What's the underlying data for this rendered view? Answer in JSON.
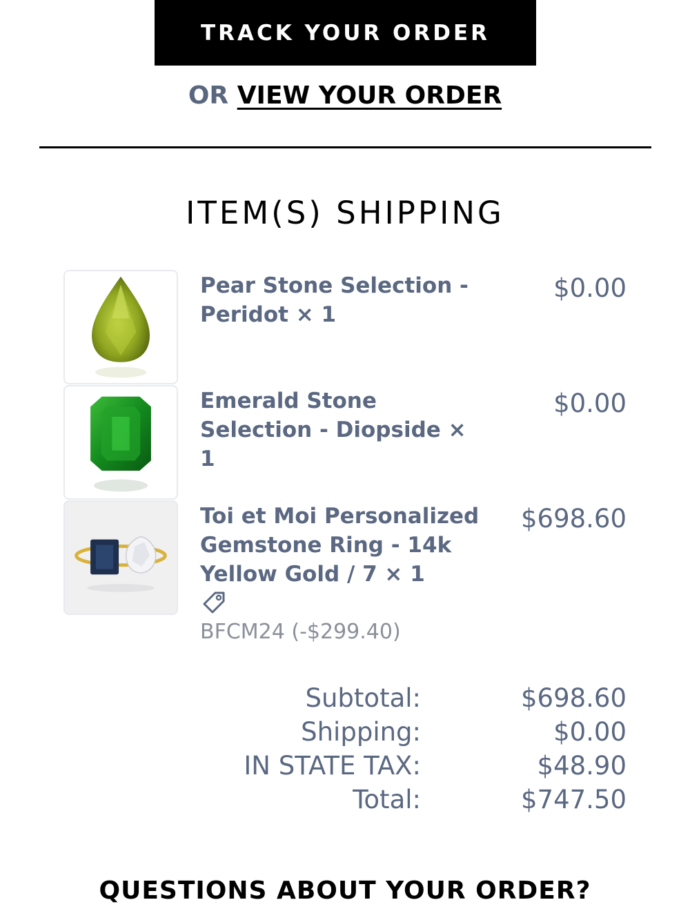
{
  "header": {
    "track_label": "TRACK YOUR ORDER",
    "or_text": "OR",
    "view_label": "VIEW YOUR ORDER"
  },
  "section_title": "ITEM(S) SHIPPING",
  "items": [
    {
      "name_lines": [
        "Pear Stone Selection -",
        "Peridot × 1"
      ],
      "price": "$0.00",
      "image_icon": "peridot-pear-gem-icon"
    },
    {
      "name_lines": [
        "Emerald Stone",
        "Selection - Diopside ×",
        "1"
      ],
      "price": "$0.00",
      "image_icon": "diopside-emerald-gem-icon"
    },
    {
      "name_lines": [
        "Toi et Moi Personalized",
        "Gemstone Ring - 14k",
        "Yellow Gold / 7 × 1"
      ],
      "price": "$698.60",
      "image_icon": "toi-et-moi-ring-icon",
      "discount": "BFCM24 (-$299.40)",
      "discount_icon": "tag-icon"
    }
  ],
  "summary": [
    {
      "label": "Subtotal:",
      "value": "$698.60"
    },
    {
      "label": "Shipping:",
      "value": "$0.00"
    },
    {
      "label": "IN STATE TAX:",
      "value": "$48.90"
    },
    {
      "label": "Total:",
      "value": "$747.50"
    }
  ],
  "footer": {
    "questions": "QUESTIONS ABOUT YOUR ORDER?"
  },
  "colors": {
    "accent_text": "#5b6882",
    "button_bg": "#000000",
    "muted": "#8a8f99"
  }
}
